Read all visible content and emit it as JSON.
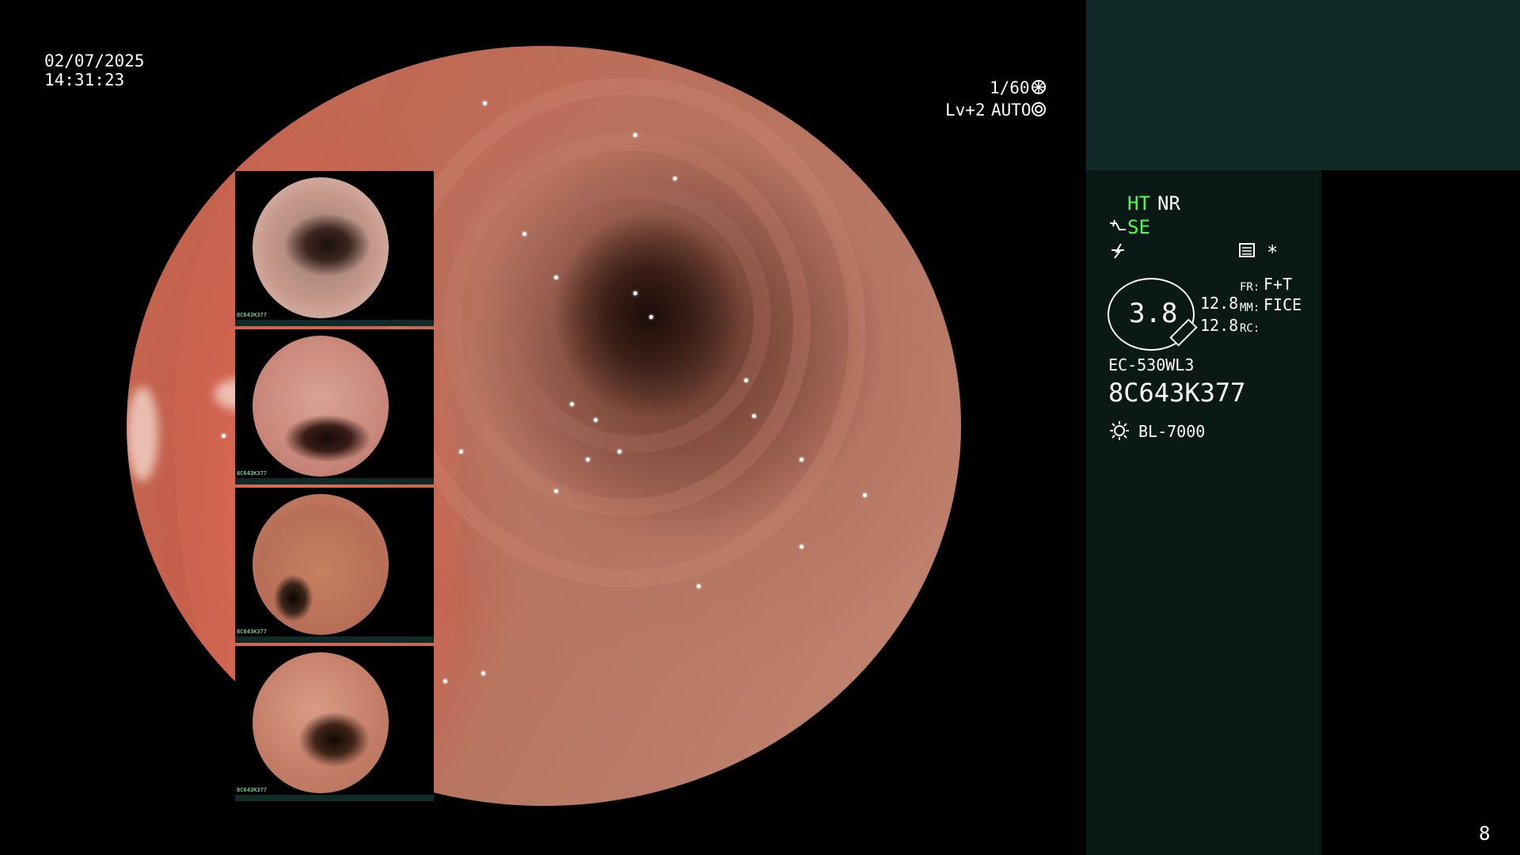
{
  "main": {
    "date": "02/07/2025",
    "time": "14:31:23",
    "shutter": "1/60",
    "level": "Lv+2",
    "auto": "AUTO"
  },
  "panel": {
    "ht": "HT",
    "nr": "NR",
    "se": "SE",
    "zoom_value": "3.8",
    "val_top": "12.8",
    "val_bottom": "12.8",
    "fr_label": "FR:",
    "fr_value": "F+T",
    "mm_label": "MM:",
    "mm_value": "FICE",
    "rc_label": "RC:",
    "scope_model": "EC-530WL3",
    "serial": "8C643K377",
    "light_source": "BL-7000",
    "page_number": "8",
    "asterisk": "*"
  },
  "thumbnails": {
    "label": "8C643K377"
  },
  "colors": {
    "status_green": "#4cff4c",
    "panel_dark": "#0a1816",
    "panel_teal": "#0f2a27"
  },
  "icons": {
    "shutter": "aperture-icon",
    "auto": "iris-icon",
    "enhance": "wave-icon",
    "lightning": "lightning-icon",
    "monitor": "monitor-icon",
    "light": "sun-icon"
  }
}
